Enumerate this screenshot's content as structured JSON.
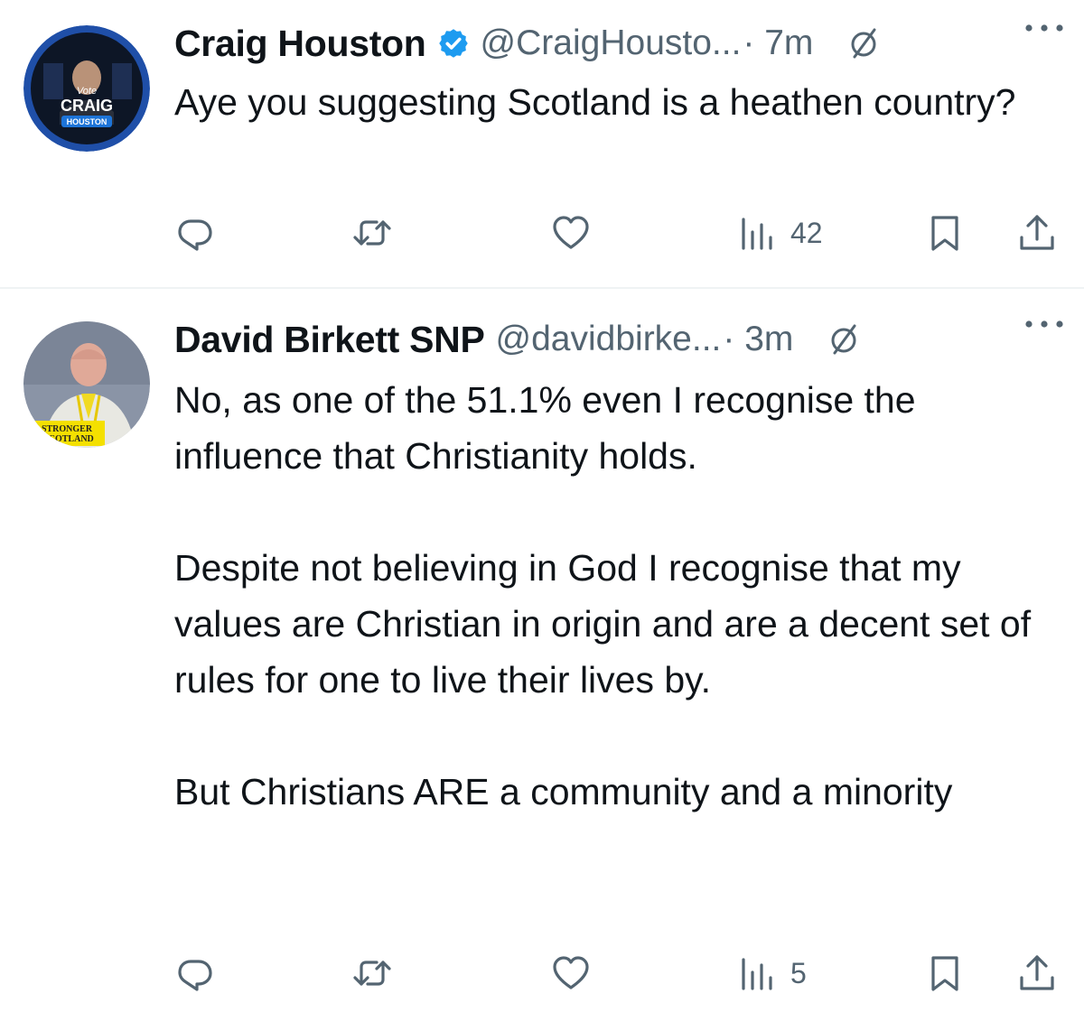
{
  "tweets": [
    {
      "author_name": "Craig Houston",
      "handle": "@CraigHousto...",
      "time": "· 7m",
      "avatar_text": {
        "line1": "Vote",
        "line2": "CRAIG",
        "line3": "HOUSTON"
      },
      "paragraphs": [
        "Aye you suggesting Scotland is a heathen country?"
      ],
      "views": "42",
      "verified": true
    },
    {
      "author_name": "David Birkett SNP",
      "handle": "@davidbirke...",
      "time": "· 3m",
      "avatar_text": {
        "line1": "STRONGER",
        "line2": "SCOTLAND"
      },
      "paragraphs": [
        "No, as one of the 51.1% even I recognise the influence that Christianity holds.",
        "Despite not believing in God I recognise that my values are Christian in origin and are a decent set of rules for one to live their lives by.",
        "But Christians ARE a community and a minority"
      ],
      "views": "5",
      "verified": false
    }
  ],
  "colors": {
    "text": "#0f1419",
    "secondary": "#536471",
    "verified": "#1d9bf0",
    "divider": "#eff3f4"
  },
  "icons": [
    "reply-icon",
    "retweet-icon",
    "like-icon",
    "views-icon",
    "bookmark-icon",
    "share-icon",
    "verified-badge-icon",
    "slash-circle-icon",
    "more-icon"
  ]
}
